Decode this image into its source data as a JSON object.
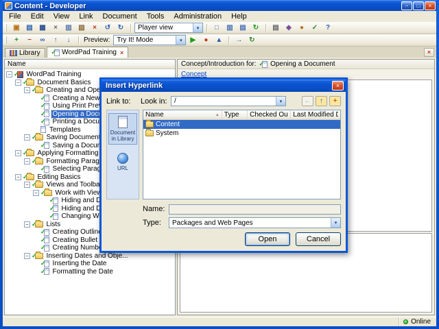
{
  "ui": {
    "dropdown_arrow": "▾",
    "sort_arrow": "▲",
    "collapse_glyph": "−",
    "check_glyph": "✓"
  },
  "window": {
    "title": "Content - Developer",
    "buttons": {
      "minimize": "−",
      "maximize": "□",
      "close": "×"
    }
  },
  "menu_bar": {
    "items": [
      "File",
      "Edit",
      "View",
      "Link",
      "Document",
      "Tools",
      "Administration",
      "Help"
    ]
  },
  "toolbar_top": {
    "icons_left": [
      {
        "id": "new-package",
        "glyph": "▣",
        "color": "#b8741a"
      },
      {
        "id": "new-document",
        "glyph": "▤",
        "color": "#3566ad"
      },
      {
        "id": "save",
        "glyph": "▦",
        "color": "#2d4f8e"
      },
      {
        "id": "cut",
        "glyph": "×",
        "color": "#6b6b6b"
      },
      {
        "id": "copy",
        "glyph": "▥",
        "color": "#5577aa"
      },
      {
        "id": "paste",
        "glyph": "▧",
        "color": "#8a6d3b"
      },
      {
        "id": "delete",
        "glyph": "×",
        "color": "#c03a2b"
      },
      {
        "id": "undo",
        "glyph": "↺",
        "color": "#2f5fb0"
      },
      {
        "id": "redo",
        "glyph": "↻",
        "color": "#2f5fb0"
      }
    ],
    "player_view_value": "Player view",
    "icons_view": [
      {
        "id": "normal-view",
        "glyph": "□",
        "color": "#4a72b8"
      },
      {
        "id": "split-view",
        "glyph": "▥",
        "color": "#4a72b8"
      },
      {
        "id": "page-view",
        "glyph": "▤",
        "color": "#4a72b8"
      },
      {
        "id": "refresh",
        "glyph": "↻",
        "color": "#1f9e1f"
      }
    ],
    "icons_right": [
      {
        "id": "properties",
        "glyph": "▤",
        "color": "#666666"
      },
      {
        "id": "metadata",
        "glyph": "◆",
        "color": "#7a4fa0"
      },
      {
        "id": "attachment",
        "glyph": "●",
        "color": "#b8741a"
      },
      {
        "id": "spell-check",
        "glyph": "✓",
        "color": "#2c8a2c"
      },
      {
        "id": "help",
        "glyph": "?",
        "color": "#2f5fb0"
      }
    ]
  },
  "toolbar_preview": {
    "icons_left": [
      {
        "id": "add-link",
        "glyph": "+",
        "color": "#2c8a2c"
      },
      {
        "id": "remove-link",
        "glyph": "−",
        "color": "#c03a2b"
      },
      {
        "id": "link-properties",
        "glyph": "∞",
        "color": "#2f5fb0"
      },
      {
        "id": "move-up",
        "glyph": "↑",
        "color": "#2f5fb0"
      },
      {
        "id": "move-down",
        "glyph": "↓",
        "color": "#2f5fb0"
      }
    ],
    "preview_label": "Preview:",
    "preview_mode_value": "Try It! Mode",
    "icons_mid": [
      {
        "id": "run-preview",
        "glyph": "▶",
        "color": "#1f9e1f"
      },
      {
        "id": "capture",
        "glyph": "●",
        "color": "#c03a2b"
      },
      {
        "id": "publish",
        "glyph": "▲",
        "color": "#2f5fb0"
      }
    ],
    "icons_right": [
      {
        "id": "export",
        "glyph": "→",
        "color": "#2f5fb0"
      },
      {
        "id": "sync",
        "glyph": "↻",
        "color": "#2c8a2c"
      }
    ]
  },
  "tab_bar": {
    "close_glyph": "×",
    "tabs": [
      {
        "label": "Library",
        "active": false
      },
      {
        "label": "WordPad Training",
        "active": true
      }
    ]
  },
  "tree": {
    "column_header": "Name",
    "items": [
      {
        "label": "WordPad Training",
        "level": 0,
        "branch": true,
        "icon": "course",
        "check": true
      },
      {
        "label": "Document Basics",
        "level": 1,
        "branch": true,
        "icon": "folder",
        "check": true
      },
      {
        "label": "Creating and Opening Doc...",
        "level": 2,
        "branch": true,
        "icon": "folder",
        "check": true
      },
      {
        "label": "Creating a New Docu...",
        "level": 3,
        "icon": "topic",
        "check": true
      },
      {
        "label": "Using Print Preview",
        "level": 3,
        "icon": "topic",
        "check": true
      },
      {
        "label": "Opening a Document",
        "level": 3,
        "icon": "topic",
        "check": true,
        "selected": true
      },
      {
        "label": "Printing a Document",
        "level": 3,
        "icon": "topic",
        "check": true
      },
      {
        "label": "Templates",
        "level": 3,
        "icon": "topic",
        "check": false
      },
      {
        "label": "Saving Documents",
        "level": 2,
        "branch": true,
        "icon": "folder",
        "check": true
      },
      {
        "label": "Saving a Document as...",
        "level": 3,
        "icon": "topic",
        "check": true
      },
      {
        "label": "Applying Formatting",
        "level": 1,
        "branch": true,
        "icon": "folder",
        "check": true
      },
      {
        "label": "Formatting Paragraphs",
        "level": 2,
        "branch": true,
        "icon": "folder",
        "check": true
      },
      {
        "label": "Selecting Paragraph T...",
        "level": 3,
        "icon": "topic",
        "check": true
      },
      {
        "label": "Editing Basics",
        "level": 1,
        "branch": true,
        "icon": "folder",
        "check": true
      },
      {
        "label": "Views and Toolbars",
        "level": 2,
        "branch": true,
        "icon": "folder",
        "check": true
      },
      {
        "label": "Work with Views",
        "level": 3,
        "branch": true,
        "icon": "folder",
        "check": true
      },
      {
        "label": "Hiding and Display...",
        "level": 4,
        "icon": "topic",
        "check": true
      },
      {
        "label": "Hiding and Display...",
        "level": 4,
        "icon": "topic",
        "check": true
      },
      {
        "label": "Changing Word W...",
        "level": 4,
        "icon": "topic",
        "check": true
      },
      {
        "label": "Lists",
        "level": 2,
        "branch": true,
        "icon": "folder",
        "check": true
      },
      {
        "label": "Creating Outlines",
        "level": 3,
        "icon": "topic",
        "check": true
      },
      {
        "label": "Creating Bullet Lists",
        "level": 3,
        "icon": "topic",
        "check": true
      },
      {
        "label": "Creating Number Lists",
        "level": 3,
        "icon": "topic",
        "check": true
      },
      {
        "label": "Inserting Dates and Obje...",
        "level": 2,
        "branch": true,
        "icon": "folder",
        "check": true
      },
      {
        "label": "Inserting the Date",
        "level": 3,
        "icon": "topic",
        "check": true
      },
      {
        "label": "Formatting the Date",
        "level": 3,
        "icon": "topic",
        "check": true
      }
    ]
  },
  "content": {
    "header_prefix": "Concept/Introduction for:",
    "header_item": "Opening a Document",
    "concept_link": "Concept"
  },
  "status_bar": {
    "online": "Online"
  },
  "dialog": {
    "title": "Insert Hyperlink",
    "close_glyph": "×",
    "link_to_label": "Link to:",
    "look_in_label": "Look in:",
    "look_in_value": "/",
    "nav_buttons": [
      {
        "id": "back",
        "glyph": "←",
        "color": "#9ab0cc",
        "bg": "#f4f2e8"
      },
      {
        "id": "up-one-level",
        "glyph": "↑",
        "color": "#1a56a8",
        "bg": "#fbe6a0"
      },
      {
        "id": "new-folder",
        "glyph": "+",
        "color": "#c0651a",
        "bg": "#fbe6a0"
      }
    ],
    "places": [
      {
        "label": "Document in Library",
        "icon": "document-in-library",
        "selected": true
      },
      {
        "label": "URL",
        "icon": "url",
        "selected": false
      }
    ],
    "list": {
      "columns": [
        "Name",
        "Type",
        "Checked Out By",
        "Last Modified Date"
      ],
      "rows": [
        {
          "name": "Content",
          "type": "",
          "checked_out_by": "",
          "last_modified_date": "",
          "selected": true
        },
        {
          "name": "System",
          "type": "",
          "checked_out_by": "",
          "last_modified_date": "",
          "selected": false
        }
      ]
    },
    "name_label": "Name:",
    "name_value": "",
    "type_label": "Type:",
    "type_value": "Packages and Web Pages",
    "buttons": {
      "open": "Open",
      "cancel": "Cancel"
    }
  }
}
